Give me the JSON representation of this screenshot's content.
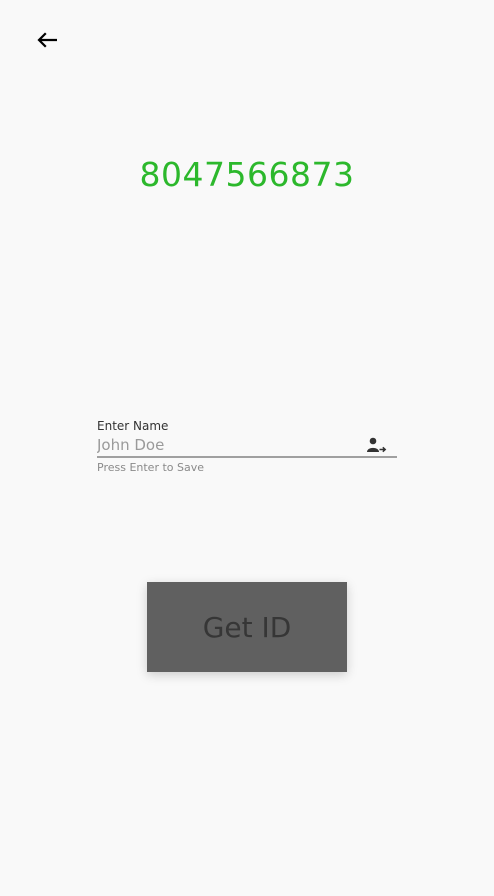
{
  "header": {
    "back_icon": "arrow-left-icon"
  },
  "id_display": {
    "value": "8047566873",
    "color": "#2cb82c"
  },
  "name_field": {
    "label": "Enter Name",
    "placeholder": "John Doe",
    "value": "",
    "helper": "Press Enter to Save",
    "icon": "person-arrow-right-icon"
  },
  "actions": {
    "get_id_label": "Get ID",
    "button_color": "#606060"
  }
}
